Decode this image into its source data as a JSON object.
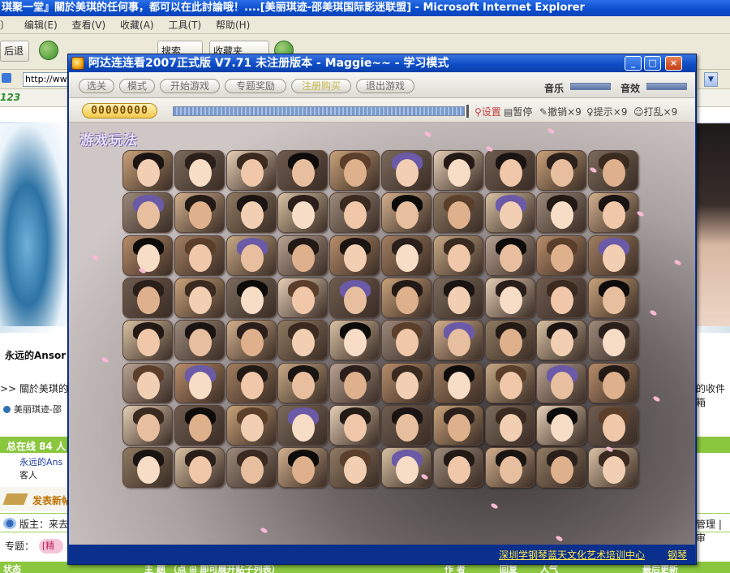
{
  "browser": {
    "title": "琪聚一堂』關於美琪的任何事，都可以在此討論哦！....[美丽琪迹-邵美琪国际影迷联盟] - Microsoft Internet Explorer",
    "menu": [
      "〕",
      "编辑(E)",
      "查看(V)",
      "收藏(A)",
      "工具(T)",
      "帮助(H)"
    ],
    "toolbar": {
      "back_label": "后退",
      "search_label": "搜索",
      "favorites_label": "收藏夹"
    },
    "address_value": "http://www",
    "links_logo": "123"
  },
  "page": {
    "user_heading": "永远的Ansor",
    "notice": ">> 關於美琪的",
    "notice_right": "的收件箱",
    "link1": "美丽琪迹-邵",
    "online_label": "总在线 84 人",
    "online_user": "永远的Ans",
    "online_guest": "客人",
    "post_label": "发表新帖",
    "moderator_label": "版主：来去",
    "manage_label": "管理 | 审",
    "topic_label": "专题：",
    "topic_tag": "[精",
    "table_header": {
      "status": "状态",
      "subject": "主 题 （点 ⊞ 即可展开贴子列表）",
      "author": "作 者",
      "replies": "回复",
      "views": "人气",
      "last_update": "最后更新"
    }
  },
  "game": {
    "title": "阿达连连看2007正式版 V7.71 未注册版本 - Maggie~~ - 学习模式",
    "window_buttons": {
      "minimize": "_",
      "maximize": "□",
      "close": "×"
    },
    "menu": [
      "选关",
      "模式",
      "开始游戏",
      "专题奖励",
      "注册购买",
      "退出游戏"
    ],
    "music_label": "音乐",
    "sound_label": "音效",
    "score": "00000000",
    "status_items": {
      "settings": "设置",
      "pause": "暂停",
      "undo": "撤销×9",
      "hint": "提示×9",
      "shuffle": "打乱×9"
    },
    "board_logo": "游戏玩法",
    "footer_link": "深圳学钢琴蓝天文化艺术培训中心",
    "footer_link2": "钢琴",
    "grid": {
      "rows": 8,
      "cols": 10
    }
  },
  "colors": {
    "title_blue": "#0a4ccc",
    "game_frame": "#0c3aa2",
    "footer_text": "#ffe84a",
    "forum_green": "#8bc63f"
  }
}
